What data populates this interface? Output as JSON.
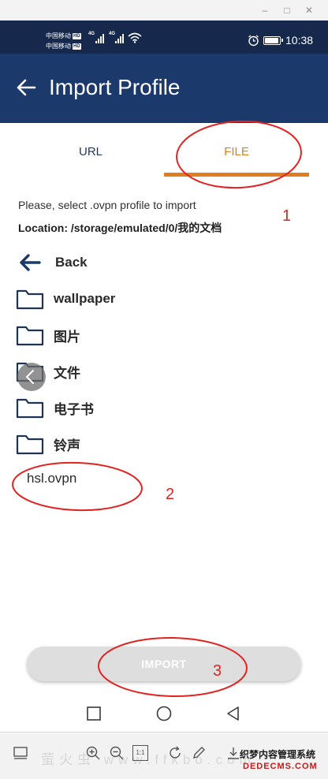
{
  "window": {
    "minimize_icon": "minimize-icon",
    "maximize_icon": "maximize-icon",
    "close_icon": "close-icon"
  },
  "status_bar": {
    "carrier_1": "中国移动",
    "carrier_2": "中国移动",
    "hd_badge": "HD",
    "network": "4G",
    "time": "10:38",
    "battery_level": 0.85,
    "icons": [
      "signal-icon",
      "wifi-icon",
      "alarm-icon",
      "battery-icon"
    ]
  },
  "app_bar": {
    "title": "Import Profile",
    "back_icon": "arrow-left-icon"
  },
  "tabs": [
    {
      "label": "URL",
      "active": false
    },
    {
      "label": "FILE",
      "active": true
    }
  ],
  "browser": {
    "prompt": "Please, select .ovpn profile to import",
    "location": "Location: /storage/emulated/0/我的文档",
    "back_label": "Back",
    "folders": [
      "wallpaper",
      "图片",
      "文件",
      "电子书",
      "铃声"
    ],
    "files": [
      "hsl.ovpn"
    ]
  },
  "import_button": {
    "label": "IMPORT"
  },
  "nav_bar": {
    "icons": [
      "square-icon",
      "circle-icon",
      "triangle-back-icon"
    ]
  },
  "viewer_toolbar": {
    "watermark": "萤火虫 www.ffkbo.com",
    "site_line_1": "织梦内容管理系统",
    "site_line_2": "DEDECMS.COM",
    "icons": [
      "panel-icon",
      "zoom-in-icon",
      "zoom-out-icon",
      "actual-size-icon",
      "rotate-icon",
      "edit-icon",
      "download-icon"
    ],
    "actual_size_label": "1:1"
  },
  "annotations": [
    "1",
    "2",
    "3"
  ],
  "colors": {
    "status_bar": "#16294d",
    "app_bar": "#1b3a6b",
    "tab_active": "#e07e1f",
    "tab_inactive": "#233a5c",
    "annotation": "#e32222",
    "import_disabled": "#dedede"
  }
}
